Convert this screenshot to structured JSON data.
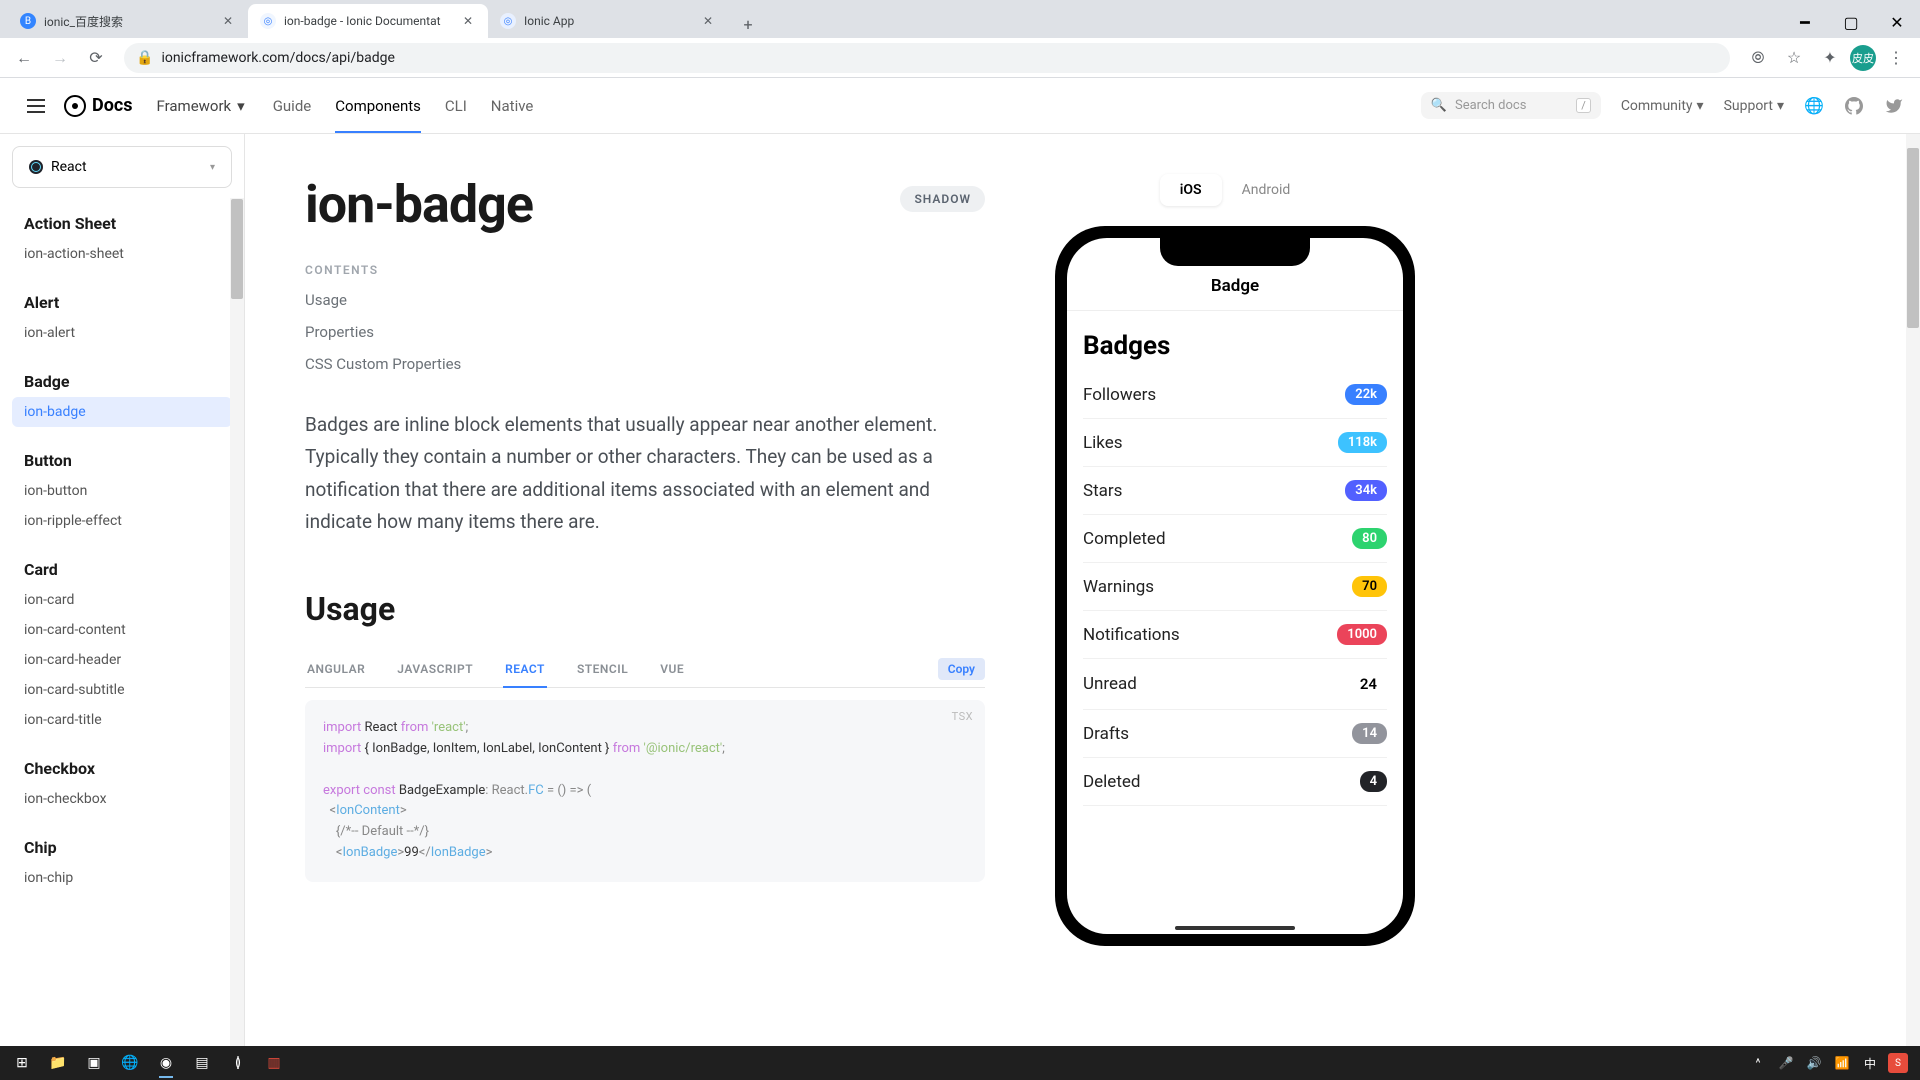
{
  "browser": {
    "tabs": [
      {
        "title": "ionic_百度搜索",
        "favicon_bg": "#3385ff",
        "favicon_txt": "B",
        "active": false
      },
      {
        "title": "ion-badge - Ionic Documentat",
        "favicon_bg": "#f0f6ff",
        "favicon_txt": "◎",
        "active": true
      },
      {
        "title": "Ionic App",
        "favicon_bg": "#e8f0ff",
        "favicon_txt": "◎",
        "active": false
      }
    ],
    "url": "ionicframework.com/docs/api/badge",
    "avatar_text": "皮皮"
  },
  "topnav": {
    "logo": "Docs",
    "framework_label": "Framework",
    "links": [
      "Guide",
      "Components",
      "CLI",
      "Native"
    ],
    "active_link": "Components",
    "search_placeholder": "Search docs",
    "search_kbd": "/",
    "community": "Community",
    "support": "Support"
  },
  "sidebar": {
    "selector": "React",
    "groups": [
      {
        "title": "Action Sheet",
        "items": [
          "ion-action-sheet"
        ]
      },
      {
        "title": "Alert",
        "items": [
          "ion-alert"
        ]
      },
      {
        "title": "Badge",
        "items": [
          "ion-badge"
        ],
        "active_item": "ion-badge"
      },
      {
        "title": "Button",
        "items": [
          "ion-button",
          "ion-ripple-effect"
        ]
      },
      {
        "title": "Card",
        "items": [
          "ion-card",
          "ion-card-content",
          "ion-card-header",
          "ion-card-subtitle",
          "ion-card-title"
        ]
      },
      {
        "title": "Checkbox",
        "items": [
          "ion-checkbox"
        ]
      },
      {
        "title": "Chip",
        "items": [
          "ion-chip"
        ]
      }
    ]
  },
  "page": {
    "title": "ion-badge",
    "shadow": "SHADOW",
    "contents_label": "CONTENTS",
    "toc": [
      "Usage",
      "Properties",
      "CSS Custom Properties"
    ],
    "description": "Badges are inline block elements that usually appear near another element. Typically they contain a number or other characters. They can be used as a notification that there are additional items associated with an element and indicate how many items there are.",
    "usage_heading": "Usage",
    "code_tabs": [
      "ANGULAR",
      "JAVASCRIPT",
      "REACT",
      "STENCIL",
      "VUE"
    ],
    "active_code_tab": "REACT",
    "copy_label": "Copy",
    "code_lang": "TSX",
    "code": {
      "l1_import": "import",
      "l1_react": "React",
      "l1_from": "from",
      "l1_str": "'react'",
      "l2_import": "import",
      "l2_items": "{ IonBadge, IonItem, IonLabel, IonContent }",
      "l2_from": "from",
      "l2_str": "'@ionic/react'",
      "l3_export": "export",
      "l3_const": "const",
      "l3_name": "BadgeExample",
      "l3_type": ": React.",
      "l3_fc": "FC",
      "l3_arrow": " = () => (",
      "l4_tag": "IonContent",
      "l5_comment": "{/*-- Default --*/}",
      "l6_tag": "IonBadge",
      "l6_val": "99"
    }
  },
  "preview": {
    "platforms": [
      "iOS",
      "Android"
    ],
    "active_platform": "iOS",
    "header": "Badge",
    "section_title": "Badges",
    "rows": [
      {
        "label": "Followers",
        "value": "22k",
        "bg": "#3880ff",
        "fg": "#fff"
      },
      {
        "label": "Likes",
        "value": "118k",
        "bg": "#3dc2ff",
        "fg": "#fff"
      },
      {
        "label": "Stars",
        "value": "34k",
        "bg": "#5260ff",
        "fg": "#fff"
      },
      {
        "label": "Completed",
        "value": "80",
        "bg": "#2dd36f",
        "fg": "#fff"
      },
      {
        "label": "Warnings",
        "value": "70",
        "bg": "#ffc409",
        "fg": "#000"
      },
      {
        "label": "Notifications",
        "value": "1000",
        "bg": "#eb445a",
        "fg": "#fff"
      },
      {
        "label": "Unread",
        "value": "24",
        "bg": "transparent",
        "fg": "#000"
      },
      {
        "label": "Drafts",
        "value": "14",
        "bg": "#92949c",
        "fg": "#fff"
      },
      {
        "label": "Deleted",
        "value": "4",
        "bg": "#222428",
        "fg": "#fff"
      }
    ]
  },
  "taskbar": {
    "time": "",
    "tray_lang": "中"
  }
}
